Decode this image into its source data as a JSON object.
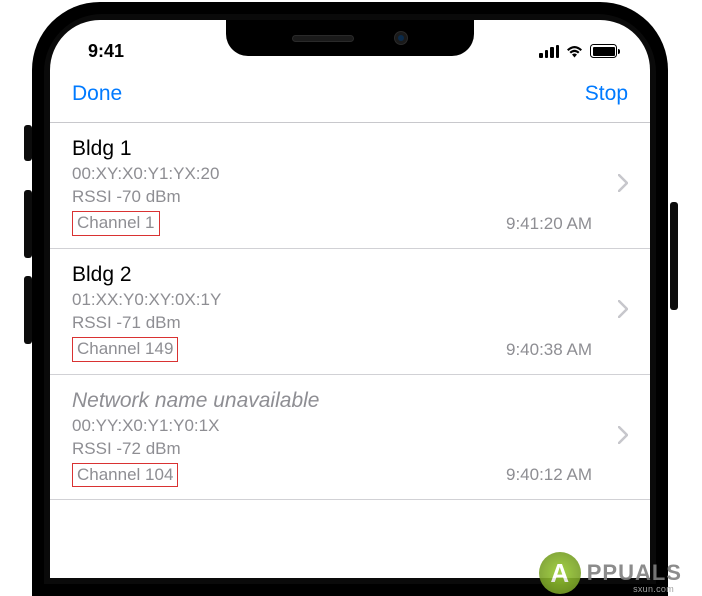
{
  "status": {
    "time": "9:41"
  },
  "nav": {
    "done": "Done",
    "stop": "Stop"
  },
  "networks": [
    {
      "name": "Bldg 1",
      "unavailable": false,
      "mac": "00:XY:X0:Y1:YX:20",
      "rssi": "RSSI -70 dBm",
      "channel": "Channel 1",
      "time": "9:41:20 AM"
    },
    {
      "name": "Bldg 2",
      "unavailable": false,
      "mac": "01:XX:Y0:XY:0X:1Y",
      "rssi": "RSSI -71 dBm",
      "channel": "Channel 149",
      "time": "9:40:38 AM"
    },
    {
      "name": "Network name unavailable",
      "unavailable": true,
      "mac": "00:YY:X0:Y1:Y0:1X",
      "rssi": "RSSI -72 dBm",
      "channel": "Channel 104",
      "time": "9:40:12 AM"
    }
  ],
  "watermark": {
    "logo": "A",
    "text": "PPUALS"
  },
  "source": "sxun.com"
}
